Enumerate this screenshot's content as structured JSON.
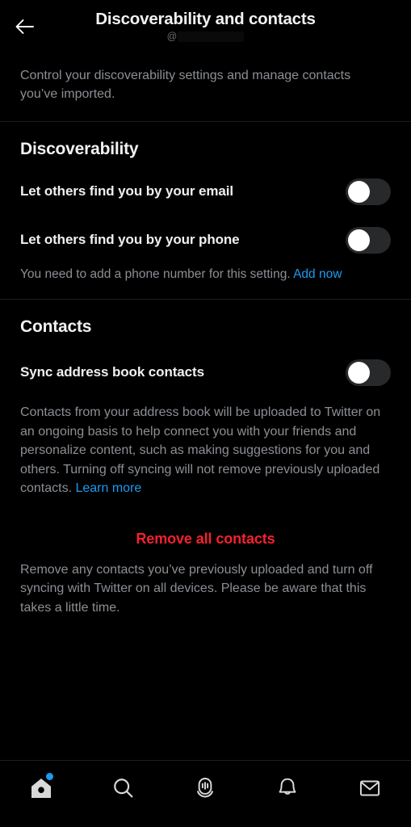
{
  "header": {
    "title": "Discoverability and contacts",
    "handle_prefix": "@",
    "handle_redacted": true,
    "back_icon": "arrow-left-icon"
  },
  "intro": {
    "text": "Control your discoverability settings and manage contacts you’ve imported."
  },
  "discoverability": {
    "heading": "Discoverability",
    "rows": [
      {
        "label": "Let others find you by your email",
        "toggle_state": "off"
      },
      {
        "label": "Let others find you by your phone",
        "toggle_state": "off"
      }
    ],
    "helper_text": "You need to add a phone number for this setting. ",
    "helper_link": "Add now"
  },
  "contacts": {
    "heading": "Contacts",
    "sync_row": {
      "label": "Sync address book contacts",
      "toggle_state": "off"
    },
    "body_text": "Contacts from your address book will be uploaded to Twitter on an ongoing basis to help connect you with your friends and personalize content, such as making suggestions for you and others. Turning off syncing will not remove previously uploaded contacts. ",
    "body_link": "Learn more",
    "remove_button": "Remove all contacts",
    "remove_description": "Remove any contacts you’ve previously uploaded and turn off syncing with Twitter on all devices. Please be aware that this takes a little time."
  },
  "bottom_nav": {
    "items": [
      {
        "name": "home",
        "icon": "home-icon",
        "badge": true
      },
      {
        "name": "search",
        "icon": "search-icon",
        "badge": false
      },
      {
        "name": "spaces",
        "icon": "spaces-microphone-icon",
        "badge": false
      },
      {
        "name": "notifications",
        "icon": "bell-icon",
        "badge": false
      },
      {
        "name": "messages",
        "icon": "envelope-icon",
        "badge": false
      }
    ]
  },
  "colors": {
    "background": "#000000",
    "text_primary": "#f2f2f2",
    "text_secondary": "#8b8f94",
    "accent_blue": "#1d9bf0",
    "danger_red": "#f4212e",
    "toggle_track_off": "#27292b",
    "divider": "#1b1d1f"
  }
}
